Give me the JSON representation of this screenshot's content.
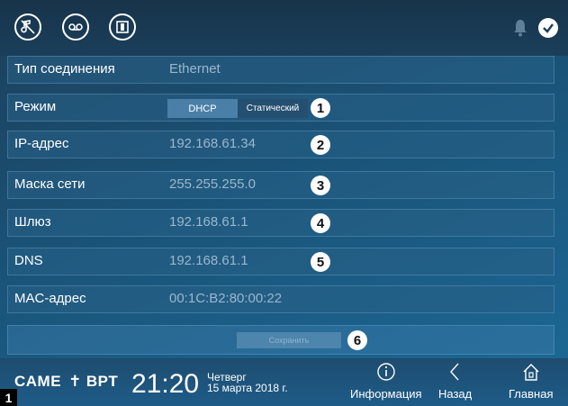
{
  "topbar": {
    "icons": [
      "mute-ringtone-icon",
      "answering-machine-icon",
      "door-open-icon"
    ],
    "status_icons": [
      "bell-icon",
      "check-icon"
    ]
  },
  "rows": [
    {
      "label": "Тип соединения",
      "value": "Ethernet"
    },
    {
      "label": "Режим",
      "mode_options": [
        "DHCP",
        "Статический"
      ],
      "selected": "DHCP",
      "marker": "1"
    },
    {
      "label": "IP-адрес",
      "value": "192.168.61.34",
      "marker": "2"
    },
    {
      "label": "Маска сети",
      "value": "255.255.255.0",
      "marker": "3"
    },
    {
      "label": "Шлюз",
      "value": "192.168.61.1",
      "marker": "4"
    },
    {
      "label": "DNS",
      "value": "192.168.61.1",
      "marker": "5"
    },
    {
      "label": "MAC-адрес",
      "value": "00:1C:B2:80:00:22"
    }
  ],
  "save": {
    "label": "Сохранить",
    "marker": "6"
  },
  "footer": {
    "brand_left": "CAME",
    "brand_right": "BPT",
    "time": "21:20",
    "weekday": "Четверг",
    "date": "15 марта 2018 г.",
    "nav": [
      {
        "label": "Информация",
        "icon": "info-icon"
      },
      {
        "label": "Назад",
        "icon": "back-icon"
      },
      {
        "label": "Главная",
        "icon": "home-icon"
      }
    ]
  },
  "corner_tag": "1",
  "colors": {
    "accent": "#4a80a7",
    "background": "#1a5378"
  }
}
